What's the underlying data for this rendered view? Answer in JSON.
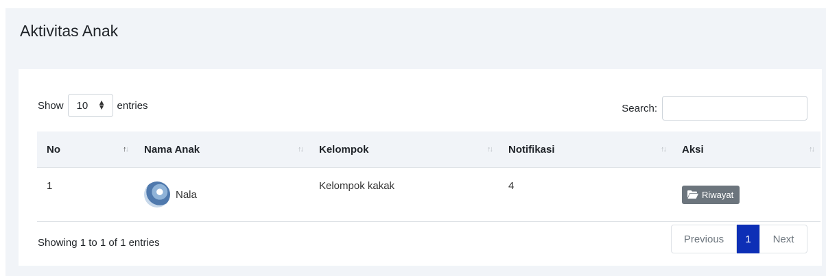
{
  "page": {
    "title": "Aktivitas Anak"
  },
  "length": {
    "prefix": "Show",
    "value": "10",
    "suffix": "entries"
  },
  "search": {
    "label": "Search:",
    "value": ""
  },
  "table": {
    "columns": [
      "No",
      "Nama Anak",
      "Kelompok",
      "Notifikasi",
      "Aksi"
    ],
    "rows": [
      {
        "no": "1",
        "nama": "Nala",
        "kelompok": "Kelompok kakak",
        "notifikasi": "4",
        "aksi": "Riwayat"
      }
    ]
  },
  "info": "Showing 1 to 1 of 1 entries",
  "pagination": {
    "previous": "Previous",
    "current": "1",
    "next": "Next"
  },
  "icons": {
    "sort": "sort-arrows-icon",
    "folder": "folder-open-icon",
    "select_arrow": "select-arrows-icon"
  },
  "colors": {
    "accent": "#0d2fb6",
    "button": "#6c757d",
    "background": "#f1f4f8"
  }
}
